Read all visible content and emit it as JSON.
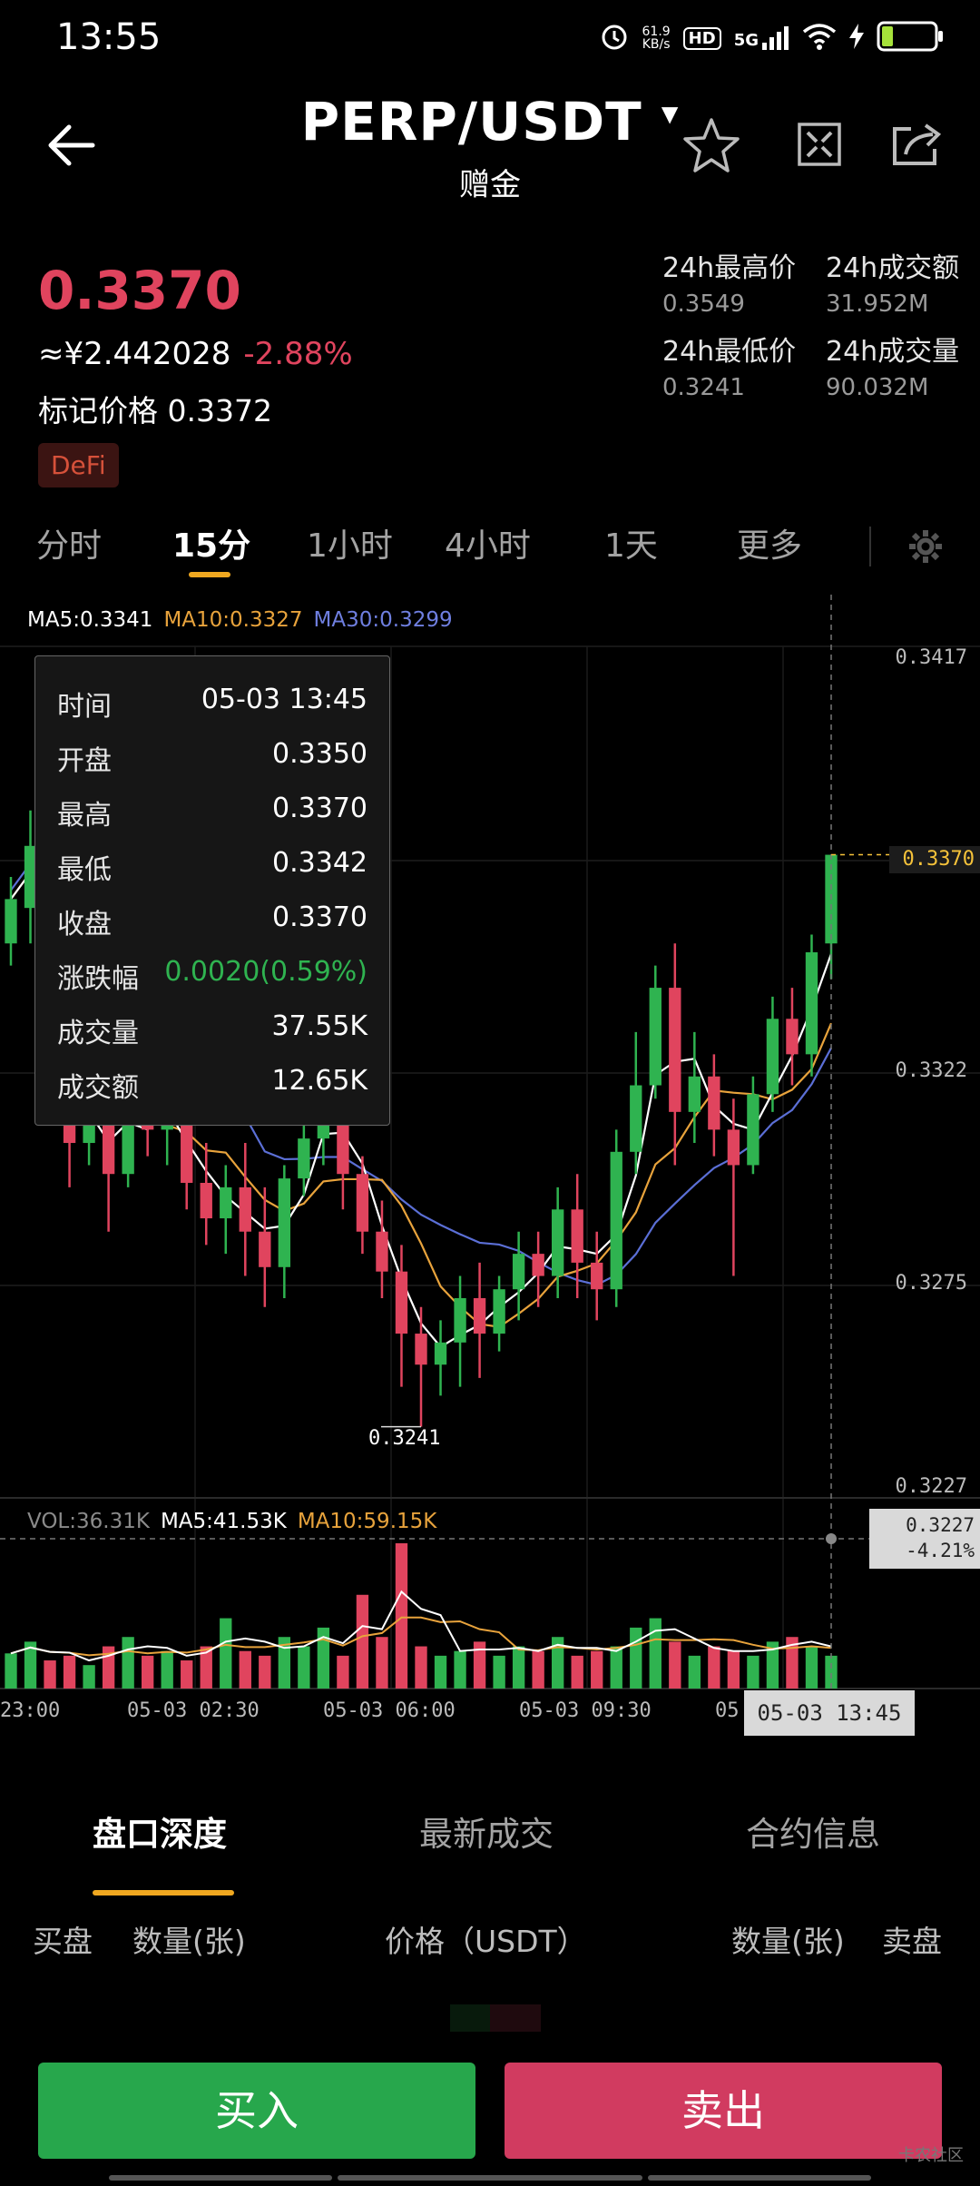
{
  "status_bar": {
    "time": "13:55",
    "net_speed": "61.9",
    "net_unit": "KB/s",
    "hd": "HD",
    "network": "5G"
  },
  "header": {
    "pair": "PERP/USDT",
    "subtitle": "赠金"
  },
  "ticker": {
    "price": "0.3370",
    "cny_price": "≈¥2.442028",
    "change_pct": "-2.88%",
    "mark_price": "标记价格 0.3372",
    "tag": "DeFi"
  },
  "stats": {
    "high_label": "24h最高价",
    "high_value": "0.3549",
    "turnover_label": "24h成交额",
    "turnover_value": "31.952M",
    "low_label": "24h最低价",
    "low_value": "0.3241",
    "volume_label": "24h成交量",
    "volume_value": "90.032M"
  },
  "tabs": [
    "分时",
    "15分",
    "1小时",
    "4小时",
    "1天",
    "更多"
  ],
  "ma_legend": {
    "ma5": "MA5:0.3341",
    "ma10": "MA10:0.3327",
    "ma30": "MA30:0.3299",
    "ma5_color": "#ffffff",
    "ma10_color": "#e8a33c",
    "ma30_color": "#5b6fd6"
  },
  "tooltip": {
    "time_label": "时间",
    "time_value": "05-03 13:45",
    "open_label": "开盘",
    "open_value": "0.3350",
    "high_label": "最高",
    "high_value": "0.3370",
    "low_label": "最低",
    "low_value": "0.3342",
    "close_label": "收盘",
    "close_value": "0.3370",
    "change_label": "涨跌幅",
    "change_value": "0.0020(0.59%)",
    "vol_label": "成交量",
    "vol_value": "37.55K",
    "amount_label": "成交额",
    "amount_value": "12.65K"
  },
  "price_axis": [
    "0.3417",
    "0.3370",
    "0.3322",
    "0.3275",
    "0.3227"
  ],
  "low_marker": "0.3241",
  "crosshair": {
    "price": "0.3227",
    "pct": "-4.21%",
    "time": "05-03 13:45"
  },
  "volume_legend": {
    "vol": "VOL:36.31K",
    "ma5": "MA5:41.53K",
    "ma10": "MA10:59.15K"
  },
  "time_axis": [
    "23:00",
    "05-03 02:30",
    "05-03 06:00",
    "05-03 09:30",
    "05"
  ],
  "bottom_tabs": [
    "盘口深度",
    "最新成交",
    "合约信息"
  ],
  "orderbook_header": {
    "bid": "买盘",
    "qty_left": "数量(张)",
    "price": "价格（USDT）",
    "qty_right": "数量(张)",
    "ask": "卖盘"
  },
  "actions": {
    "buy": "买入",
    "sell": "卖出"
  },
  "watermark": "卡农社区",
  "colors": {
    "up": "#2fb350",
    "down": "#e0445e",
    "accent": "#f0a820"
  },
  "chart_data": {
    "type": "candlestick",
    "y_range": [
      0.3227,
      0.3417
    ],
    "candles": [
      {
        "o": 0.335,
        "h": 0.3365,
        "l": 0.3345,
        "c": 0.336
      },
      {
        "o": 0.3358,
        "h": 0.338,
        "l": 0.335,
        "c": 0.3372
      },
      {
        "o": 0.334,
        "h": 0.335,
        "l": 0.331,
        "c": 0.3318
      },
      {
        "o": 0.3318,
        "h": 0.333,
        "l": 0.3295,
        "c": 0.3305
      },
      {
        "o": 0.3305,
        "h": 0.3318,
        "l": 0.33,
        "c": 0.3313
      },
      {
        "o": 0.3313,
        "h": 0.332,
        "l": 0.3285,
        "c": 0.3298
      },
      {
        "o": 0.3298,
        "h": 0.3325,
        "l": 0.3295,
        "c": 0.3318
      },
      {
        "o": 0.3318,
        "h": 0.3322,
        "l": 0.3302,
        "c": 0.3308
      },
      {
        "o": 0.3308,
        "h": 0.3315,
        "l": 0.33,
        "c": 0.3312
      },
      {
        "o": 0.3312,
        "h": 0.3318,
        "l": 0.329,
        "c": 0.3296
      },
      {
        "o": 0.3296,
        "h": 0.3305,
        "l": 0.3282,
        "c": 0.3288
      },
      {
        "o": 0.3288,
        "h": 0.33,
        "l": 0.328,
        "c": 0.3295
      },
      {
        "o": 0.3295,
        "h": 0.3305,
        "l": 0.3275,
        "c": 0.3285
      },
      {
        "o": 0.3285,
        "h": 0.3295,
        "l": 0.3268,
        "c": 0.3277
      },
      {
        "o": 0.3277,
        "h": 0.33,
        "l": 0.327,
        "c": 0.3297
      },
      {
        "o": 0.3297,
        "h": 0.331,
        "l": 0.3293,
        "c": 0.3306
      },
      {
        "o": 0.3306,
        "h": 0.3325,
        "l": 0.33,
        "c": 0.3318
      },
      {
        "o": 0.3318,
        "h": 0.3322,
        "l": 0.329,
        "c": 0.3298
      },
      {
        "o": 0.3298,
        "h": 0.3302,
        "l": 0.328,
        "c": 0.3285
      },
      {
        "o": 0.3285,
        "h": 0.3292,
        "l": 0.327,
        "c": 0.3276
      },
      {
        "o": 0.3276,
        "h": 0.3282,
        "l": 0.325,
        "c": 0.3262
      },
      {
        "o": 0.3262,
        "h": 0.3268,
        "l": 0.3241,
        "c": 0.3255
      },
      {
        "o": 0.3255,
        "h": 0.3265,
        "l": 0.3248,
        "c": 0.326
      },
      {
        "o": 0.326,
        "h": 0.3275,
        "l": 0.325,
        "c": 0.327
      },
      {
        "o": 0.327,
        "h": 0.3278,
        "l": 0.3252,
        "c": 0.3262
      },
      {
        "o": 0.3262,
        "h": 0.3275,
        "l": 0.3258,
        "c": 0.3272
      },
      {
        "o": 0.3272,
        "h": 0.3285,
        "l": 0.3265,
        "c": 0.328
      },
      {
        "o": 0.328,
        "h": 0.3285,
        "l": 0.3268,
        "c": 0.3275
      },
      {
        "o": 0.3275,
        "h": 0.3295,
        "l": 0.327,
        "c": 0.329
      },
      {
        "o": 0.329,
        "h": 0.3298,
        "l": 0.327,
        "c": 0.3278
      },
      {
        "o": 0.3278,
        "h": 0.3285,
        "l": 0.3265,
        "c": 0.3272
      },
      {
        "o": 0.3272,
        "h": 0.3308,
        "l": 0.3268,
        "c": 0.3303
      },
      {
        "o": 0.3303,
        "h": 0.333,
        "l": 0.3298,
        "c": 0.3318
      },
      {
        "o": 0.3318,
        "h": 0.3345,
        "l": 0.3315,
        "c": 0.334
      },
      {
        "o": 0.334,
        "h": 0.335,
        "l": 0.33,
        "c": 0.3312
      },
      {
        "o": 0.3312,
        "h": 0.333,
        "l": 0.3305,
        "c": 0.332
      },
      {
        "o": 0.332,
        "h": 0.3325,
        "l": 0.3302,
        "c": 0.3308
      },
      {
        "o": 0.3308,
        "h": 0.3315,
        "l": 0.3275,
        "c": 0.33
      },
      {
        "o": 0.33,
        "h": 0.332,
        "l": 0.3298,
        "c": 0.3316
      },
      {
        "o": 0.3316,
        "h": 0.3338,
        "l": 0.3312,
        "c": 0.3333
      },
      {
        "o": 0.3333,
        "h": 0.334,
        "l": 0.3318,
        "c": 0.3325
      },
      {
        "o": 0.3325,
        "h": 0.3352,
        "l": 0.332,
        "c": 0.3348
      },
      {
        "o": 0.335,
        "h": 0.337,
        "l": 0.3342,
        "c": 0.337
      }
    ],
    "volumes": [
      15,
      20,
      12,
      14,
      10,
      18,
      22,
      14,
      16,
      12,
      18,
      30,
      16,
      14,
      22,
      18,
      26,
      14,
      40,
      22,
      62,
      18,
      14,
      16,
      20,
      14,
      18,
      16,
      22,
      14,
      16,
      18,
      26,
      30,
      20,
      14,
      18,
      16,
      14,
      20,
      22,
      18,
      14
    ]
  }
}
